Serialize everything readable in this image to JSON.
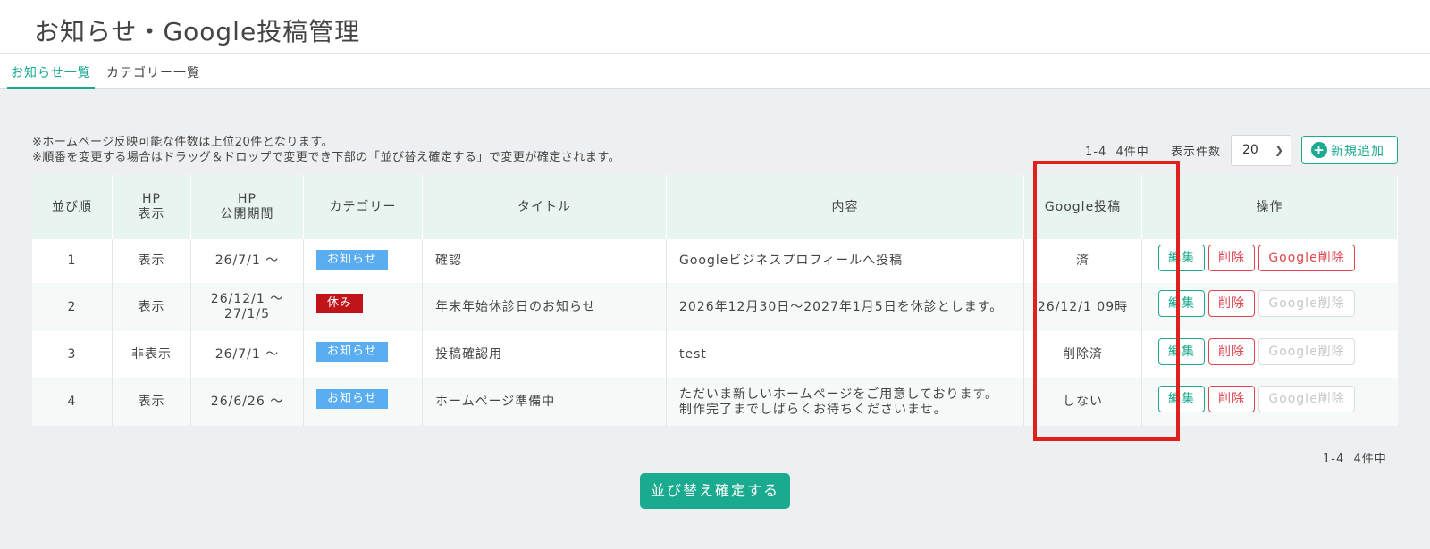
{
  "page_title": "お知らせ・Google投稿管理",
  "tabs": [
    {
      "label": "お知らせ一覧",
      "active": true
    },
    {
      "label": "カテゴリー一覧",
      "active": false
    }
  ],
  "notes": [
    "※ホームページ反映可能な件数は上位20件となります。",
    "※順番を変更する場合はドラッグ＆ドロップで変更でき下部の「並び替え確定する」で変更が確定されます。"
  ],
  "pagination": {
    "count_text": "1-4  4件中",
    "per_page_label": "表示件数",
    "per_page_value": "20"
  },
  "add_button_label": "新規追加",
  "table": {
    "headers": [
      "並び順",
      "HP\n表示",
      "HP\n公開期間",
      "カテゴリー",
      "タイトル",
      "内容",
      "Google投稿",
      "操作"
    ],
    "rows": [
      {
        "order": "1",
        "hp_display": "表示",
        "period": "26/7/1 ～",
        "category": "お知らせ",
        "category_type": "news",
        "title": "確認",
        "content": "Googleビジネスプロフィールへ投稿",
        "google_post": "済",
        "google_delete_enabled": true
      },
      {
        "order": "2",
        "hp_display": "表示",
        "period": "26/12/1 ～\n27/1/5",
        "category": "休み",
        "category_type": "closed",
        "title": "年末年始休診日のお知らせ",
        "content": "2026年12月30日～2027年1月5日を休診とします。",
        "google_post": "26/12/1 09時",
        "google_delete_enabled": false
      },
      {
        "order": "3",
        "hp_display": "非表示",
        "period": "26/7/1 ～",
        "category": "お知らせ",
        "category_type": "news",
        "title": "投稿確認用",
        "content": "test",
        "google_post": "削除済",
        "google_delete_enabled": false
      },
      {
        "order": "4",
        "hp_display": "表示",
        "period": "26/6/26 ～",
        "category": "お知らせ",
        "category_type": "news",
        "title": "ホームページ準備中",
        "content": "ただいま新しいホームページをご用意しております。\n制作完了までしばらくお待ちくださいませ。",
        "google_post": "しない",
        "google_delete_enabled": false
      }
    ],
    "actions": {
      "edit": "編集",
      "delete": "削除",
      "google_delete": "Google削除"
    }
  },
  "bottom_count_text": "1-4  4件中",
  "confirm_button_label": "並び替え確定する",
  "colors": {
    "accent": "#1aaa8f",
    "danger": "#e0454f",
    "news_badge": "#5aadf0",
    "closed_badge": "#c0141a",
    "highlight": "#e0201c"
  }
}
